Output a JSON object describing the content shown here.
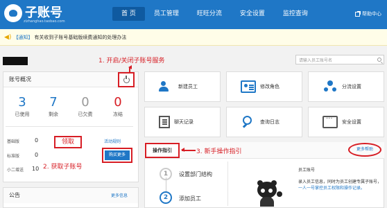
{
  "header": {
    "logo_text": "子账号",
    "logo_sub": "zizhanghao.taobao.com",
    "nav": [
      "首 页",
      "员工管理",
      "旺旺分流",
      "安全设置",
      "监控查询"
    ],
    "help": "帮助中心"
  },
  "notice": {
    "tag": "【通知】",
    "text": "有关收到子账号基础版续费通知的处理办法"
  },
  "search": {
    "placeholder": "请输入员工账号名"
  },
  "account": {
    "title": "账号概况",
    "stats": [
      {
        "value": "3",
        "label": "已使用",
        "color": "#1f77c6"
      },
      {
        "value": "7",
        "label": "剩余",
        "color": "#1f77c6"
      },
      {
        "value": "0",
        "label": "已欠费",
        "color": "#999999"
      },
      {
        "value": "0",
        "label": "冻结",
        "color": "#d71d24"
      }
    ],
    "rows": [
      {
        "label": "基础版",
        "value": "0"
      },
      {
        "label": "标准版",
        "value": "0"
      },
      {
        "label": "小二增送",
        "value": "10"
      }
    ],
    "activity_rule": "活动规则",
    "buy_more": "购买更多"
  },
  "annotations": {
    "a1": "1. 开启/关闭子账号服务",
    "a2_box": "领取",
    "a2": "2. 获取子账号",
    "a3": "3. 新手操作指引"
  },
  "announcement": {
    "title": "公告",
    "more": "更多信息"
  },
  "tiles": [
    {
      "label": "新建员工",
      "icon": "users-icon"
    },
    {
      "label": "修改角色",
      "icon": "id-card-icon"
    },
    {
      "label": "分流设置",
      "icon": "nodes-icon"
    },
    {
      "label": "聊天记录",
      "icon": "document-icon"
    },
    {
      "label": "查询日志",
      "icon": "search-icon"
    },
    {
      "label": "安全设置",
      "icon": "security-dots-icon"
    }
  ],
  "guide": {
    "title": "操作指引",
    "more_help": "更多帮助",
    "steps": [
      {
        "num": "1",
        "label": "设置部门结构"
      },
      {
        "num": "2",
        "label": "添加员工"
      }
    ],
    "side_title": "员工账号",
    "side_text_1": "录入员工信息，同时为员工创建专属子账号，",
    "side_text_hl": "一人一号掌控员工权限和操作记录。"
  },
  "colors": {
    "brand": "#1f77c6",
    "annotation_red": "#d71d24",
    "nav_active": "#0f5aa0"
  }
}
